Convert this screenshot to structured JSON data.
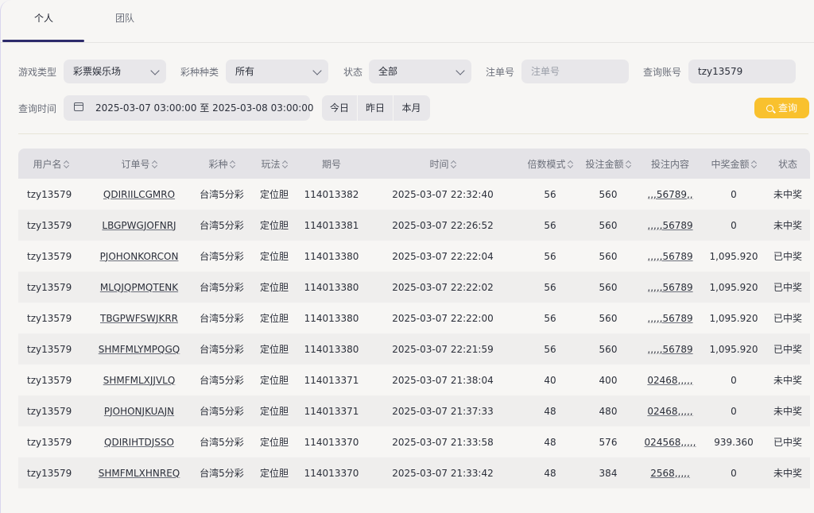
{
  "tabs": [
    {
      "label": "个人",
      "active": true
    },
    {
      "label": "团队",
      "active": false
    }
  ],
  "filters": {
    "game_type_label": "游戏类型",
    "game_type_value": "彩票娱乐场",
    "lottery_label": "彩种种类",
    "lottery_value": "所有",
    "status_label": "状态",
    "status_value": "全部",
    "order_label": "注单号",
    "order_placeholder": "注单号",
    "account_label": "查询账号",
    "account_value": "tzy13579",
    "time_label": "查询时间",
    "time_value": "2025-03-07 03:00:00 至 2025-03-08 03:00:00",
    "quick_ranges": [
      "今日",
      "昨日",
      "本月"
    ],
    "query_button": "查询"
  },
  "colors": {
    "accent": "#2d2b6b",
    "query_button": "#f9c12e"
  },
  "table": {
    "headers": [
      "用户名",
      "订单号",
      "彩种",
      "玩法",
      "期号",
      "时间",
      "倍数模式",
      "投注金额",
      "投注内容",
      "中奖金额",
      "状态"
    ],
    "sortable": [
      true,
      true,
      true,
      true,
      false,
      true,
      true,
      true,
      false,
      true,
      false
    ],
    "rows": [
      [
        "tzy13579",
        "QDIRIILCGMRO",
        "台湾5分彩",
        "定位胆",
        "114013382",
        "2025-03-07 22:32:40",
        "56",
        "560",
        ",,,56789,,",
        "0",
        "未中奖"
      ],
      [
        "tzy13579",
        "LBGPWGJOFNRJ",
        "台湾5分彩",
        "定位胆",
        "114013381",
        "2025-03-07 22:26:52",
        "56",
        "560",
        ",,,,,56789",
        "0",
        "未中奖"
      ],
      [
        "tzy13579",
        "PJOHONKORCON",
        "台湾5分彩",
        "定位胆",
        "114013380",
        "2025-03-07 22:22:04",
        "56",
        "560",
        ",,,,,56789",
        "1,095.920",
        "已中奖"
      ],
      [
        "tzy13579",
        "MLQJQPMQTENK",
        "台湾5分彩",
        "定位胆",
        "114013380",
        "2025-03-07 22:22:02",
        "56",
        "560",
        ",,,,,56789",
        "1,095.920",
        "已中奖"
      ],
      [
        "tzy13579",
        "TBGPWFSWJKRR",
        "台湾5分彩",
        "定位胆",
        "114013380",
        "2025-03-07 22:22:00",
        "56",
        "560",
        ",,,,,56789",
        "1,095.920",
        "已中奖"
      ],
      [
        "tzy13579",
        "SHMFMLYMPQGQ",
        "台湾5分彩",
        "定位胆",
        "114013380",
        "2025-03-07 22:21:59",
        "56",
        "560",
        ",,,,,56789",
        "1,095.920",
        "已中奖"
      ],
      [
        "tzy13579",
        "SHMFMLXJJVLQ",
        "台湾5分彩",
        "定位胆",
        "114013371",
        "2025-03-07 21:38:04",
        "40",
        "400",
        "02468,,,,,",
        "0",
        "未中奖"
      ],
      [
        "tzy13579",
        "PJOHONJKUAJN",
        "台湾5分彩",
        "定位胆",
        "114013371",
        "2025-03-07 21:37:33",
        "48",
        "480",
        "02468,,,,,",
        "0",
        "未中奖"
      ],
      [
        "tzy13579",
        "QDIRIHTDJSSO",
        "台湾5分彩",
        "定位胆",
        "114013370",
        "2025-03-07 21:33:58",
        "48",
        "576",
        "024568,,,,,",
        "939.360",
        "已中奖"
      ],
      [
        "tzy13579",
        "SHMFMLXHNREQ",
        "台湾5分彩",
        "定位胆",
        "114013370",
        "2025-03-07 21:33:42",
        "48",
        "384",
        "2568,,,,,",
        "0",
        "未中奖"
      ]
    ]
  }
}
